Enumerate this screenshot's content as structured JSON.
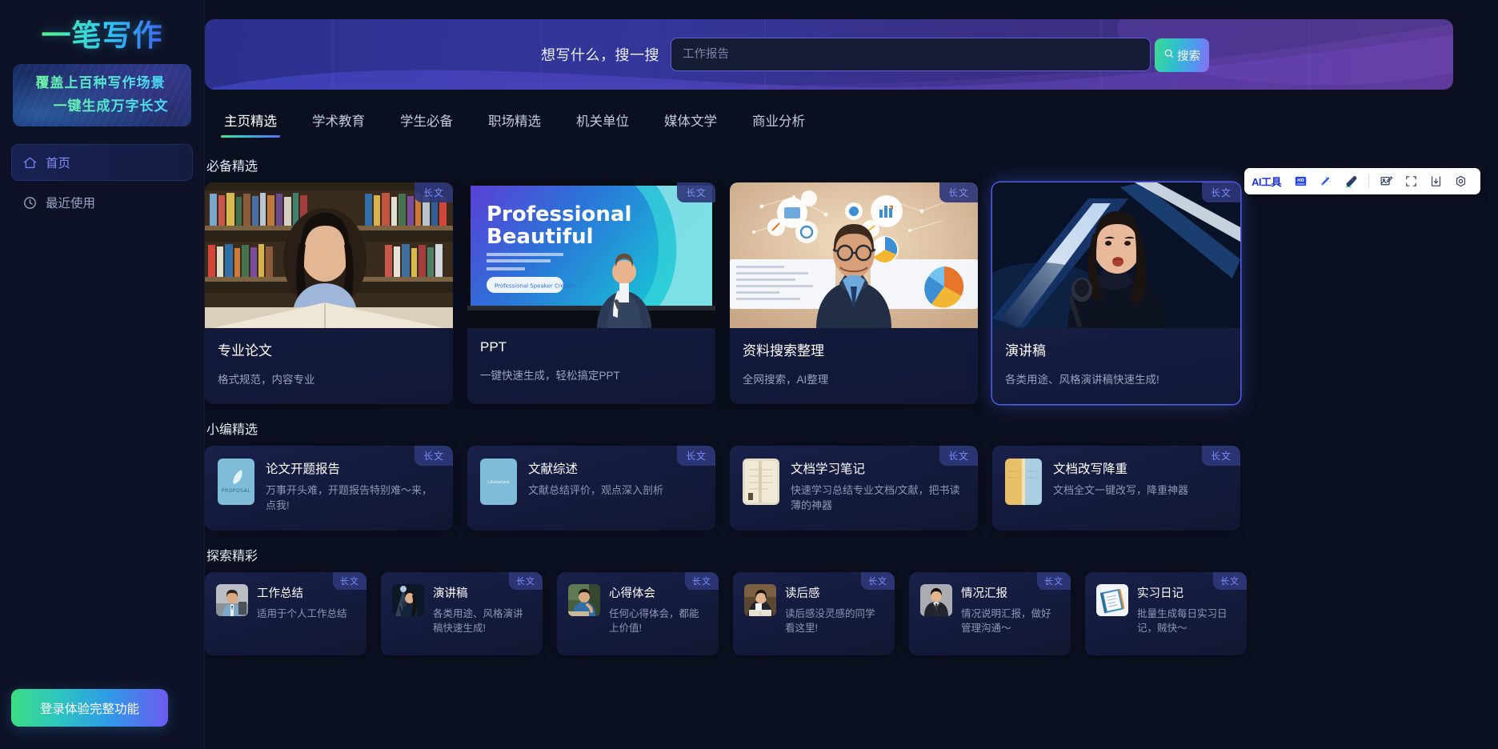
{
  "app": {
    "logo_text": "一笔写作"
  },
  "sidebar": {
    "promo": {
      "line1": "覆盖上百种写作场景",
      "line2": "一键生成万字长文"
    },
    "items": [
      {
        "label": "首页",
        "icon": "home-icon",
        "active": true
      },
      {
        "label": "最近使用",
        "icon": "clock-icon",
        "active": false
      }
    ],
    "login_button": "登录体验完整功能"
  },
  "search": {
    "label": "想写什么，搜一搜",
    "placeholder": "工作报告",
    "value": "",
    "button": "搜索",
    "button_icon": "search-icon"
  },
  "tabs": [
    {
      "label": "主页精选",
      "active": true
    },
    {
      "label": "学术教育",
      "active": false
    },
    {
      "label": "学生必备",
      "active": false
    },
    {
      "label": "职场精选",
      "active": false
    },
    {
      "label": "机关单位",
      "active": false
    },
    {
      "label": "媒体文学",
      "active": false
    },
    {
      "label": "商业分析",
      "active": false
    }
  ],
  "toolbar": {
    "ai_label": "AI工具",
    "items": [
      {
        "name": "hd-icon",
        "title": "HD"
      },
      {
        "name": "magic-wand-icon",
        "title": ""
      },
      {
        "name": "eraser-icon",
        "title": ""
      },
      {
        "name": "image-edit-icon",
        "title": ""
      },
      {
        "name": "crop-icon",
        "title": ""
      },
      {
        "name": "download-icon",
        "title": ""
      },
      {
        "name": "settings-icon",
        "title": ""
      }
    ]
  },
  "sections": [
    {
      "title": "必备精选",
      "type": "big",
      "cards": [
        {
          "name": "专业论文",
          "desc": "格式规范，内容专业",
          "tag": "长文",
          "highlight": false,
          "art": "library"
        },
        {
          "name": "PPT",
          "desc": "一键快速生成，轻松搞定PPT",
          "tag": "长文",
          "highlight": false,
          "art": "ppt"
        },
        {
          "name": "资料搜索整理",
          "desc": "全网搜索，AI整理",
          "tag": "长文",
          "highlight": false,
          "art": "analyst"
        },
        {
          "name": "演讲稿",
          "desc": "各类用途、风格演讲稿快速生成!",
          "tag": "长文",
          "highlight": true,
          "art": "speaker"
        }
      ]
    },
    {
      "title": "小编精选",
      "type": "mid",
      "cards": [
        {
          "name": "论文开题报告",
          "desc": "万事开头难，开题报告特别难～来，点我!",
          "tag": "长文",
          "icon_label": "PROPOSAL",
          "icon_art": "proposal"
        },
        {
          "name": "文献综述",
          "desc": "文献总结评价，观点深入剖析",
          "tag": "长文",
          "icon_label": "Literature",
          "icon_art": "literature"
        },
        {
          "name": "文档学习笔记",
          "desc": "快速学习总结专业文档/文献，把书读薄的神器",
          "tag": "长文",
          "icon_label": "",
          "icon_art": "notes"
        },
        {
          "name": "文档改写降重",
          "desc": "文档全文一键改写，降重神器",
          "tag": "长文",
          "icon_label": "",
          "icon_art": "rewrite"
        }
      ]
    },
    {
      "title": "探索精彩",
      "type": "small",
      "cards": [
        {
          "name": "工作总结",
          "desc": "适用于个人工作总结",
          "tag": "长文",
          "icon_art": "worker"
        },
        {
          "name": "演讲稿",
          "desc": "各类用途、风格演讲稿快速生成!",
          "tag": "长文",
          "icon_art": "stage"
        },
        {
          "name": "心得体会",
          "desc": "任何心得体会，都能上价值!",
          "tag": "长文",
          "icon_art": "student"
        },
        {
          "name": "读后感",
          "desc": "读后感没灵感的同学看这里!",
          "tag": "长文",
          "icon_art": "reader"
        },
        {
          "name": "情况汇报",
          "desc": "情况说明汇报，做好管理沟通～",
          "tag": "长文",
          "icon_art": "manager"
        },
        {
          "name": "实习日记",
          "desc": "批量生成每日实习日记，贼快～",
          "tag": "长文",
          "icon_art": "notebook"
        }
      ]
    }
  ],
  "colors": {
    "accent_green": "#3ddc84",
    "accent_blue": "#2f9ae8",
    "accent_purple": "#6b5bf0",
    "tag_text": "#7b8cf5",
    "page_bg": "#0b1020",
    "sidebar_bg": "#0d1226"
  }
}
